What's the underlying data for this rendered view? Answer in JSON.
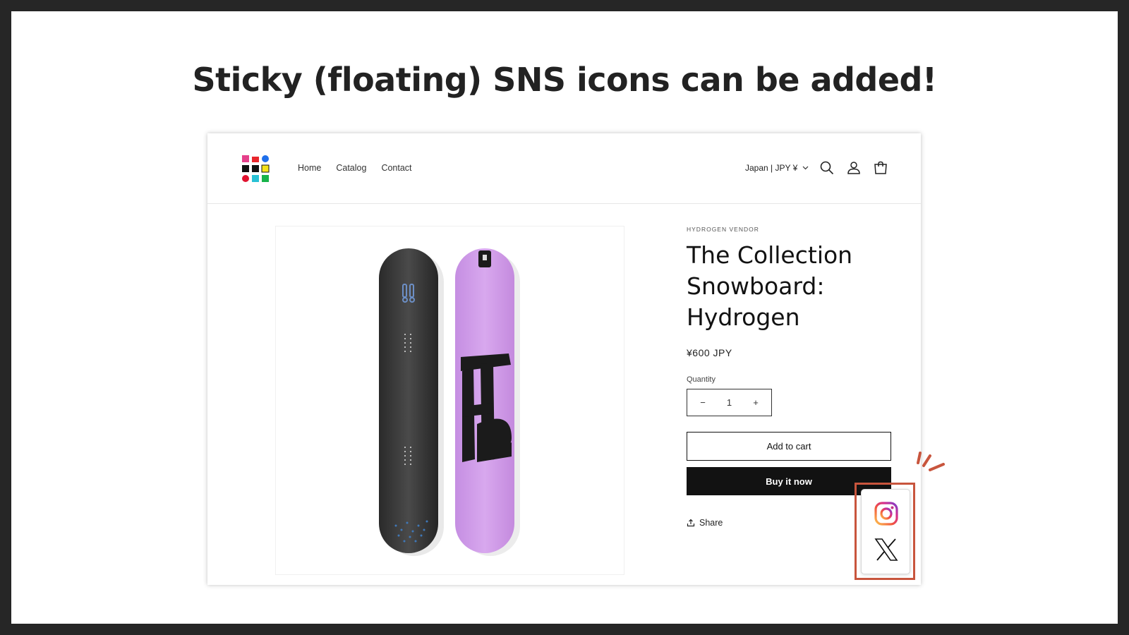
{
  "headline": "Sticky (floating) SNS icons can be added!",
  "store": {
    "nav": [
      "Home",
      "Catalog",
      "Contact"
    ],
    "country_selector": "Japan | JPY ¥",
    "header_icons": [
      "search-icon",
      "account-icon",
      "cart-icon"
    ],
    "logo_colors": [
      "#e5408a",
      "#e8262c",
      "#1f6feb",
      "#111111",
      "#111111",
      "#f4e21a",
      "#e0122f",
      "#29c1d4",
      "#17b34a"
    ]
  },
  "product": {
    "vendor": "HYDROGEN VENDOR",
    "title_lines": [
      "The Collection",
      "Snowboard:",
      "Hydrogen"
    ],
    "price": "¥600 JPY",
    "quantity_label": "Quantity",
    "quantity_value": "1",
    "decrease_symbol": "−",
    "increase_symbol": "+",
    "add_to_cart": "Add to cart",
    "buy_now": "Buy it now",
    "share": "Share"
  },
  "sns": {
    "icons": [
      "instagram-icon",
      "x-icon"
    ],
    "highlight_color": "#c8553d"
  }
}
